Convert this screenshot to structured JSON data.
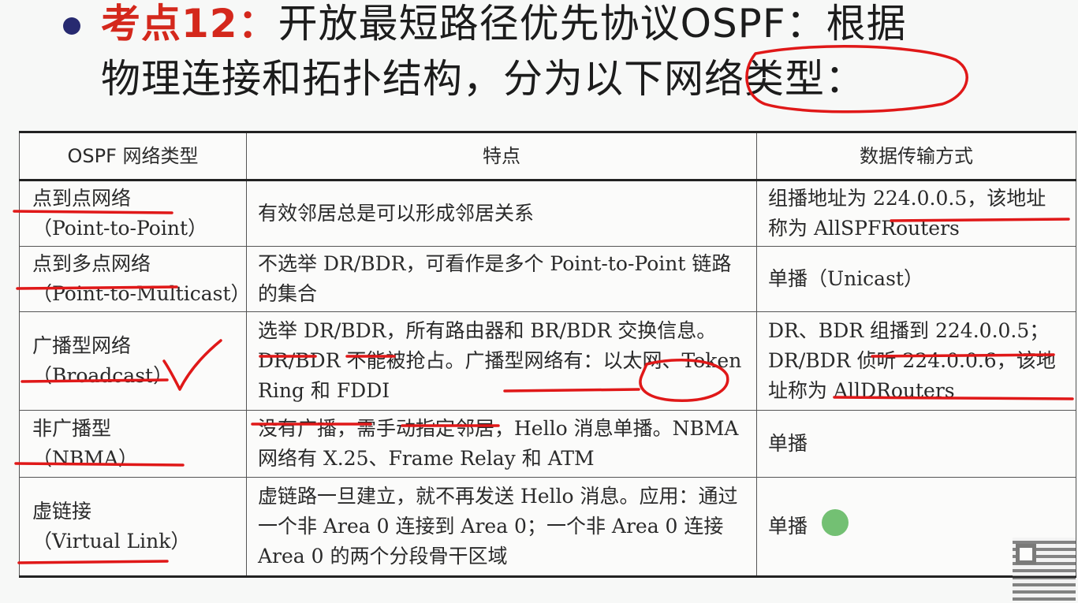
{
  "header": {
    "label": "考点12：",
    "line1": "开放最短路径优先协议OSPF：根据",
    "line2": "物理连接和拓扑结构，分为以下网络类型："
  },
  "table": {
    "columns": [
      "OSPF 网络类型",
      "特点",
      "数据传输方式"
    ],
    "rows": [
      {
        "type_zh": "点到点网络",
        "type_en": "（Point-to-Point）",
        "feature": "有效邻居总是可以形成邻居关系",
        "transmission": "组播地址为 224.0.0.5，该地址称为 AllSPFRouters"
      },
      {
        "type_zh": "点到多点网络",
        "type_en": "（Point-to-Multicast）",
        "feature": "不选举 DR/BDR，可看作是多个 Point-to-Point 链路的集合",
        "transmission": "单播（Unicast）"
      },
      {
        "type_zh": "广播型网络",
        "type_en": "（Broadcast）",
        "feature": "选举 DR/BDR，所有路由器和 BR/BDR 交换信息。DR/BDR 不能被抢占。广播型网络有：以太网、Token Ring 和 FDDI",
        "transmission": "DR、BDR 组播到 224.0.0.5；DR/BDR 侦听 224.0.0.6，该地址称为 AllDRouters"
      },
      {
        "type_zh": "非广播型",
        "type_en": "（NBMA）",
        "feature": "没有广播，需手动指定邻居，Hello 消息单播。NBMA 网络有 X.25、Frame Relay 和 ATM",
        "transmission": "单播"
      },
      {
        "type_zh": "虚链接",
        "type_en": "（Virtual Link）",
        "feature": "虚链路一旦建立，就不再发送 Hello 消息。应用：通过一个非 Area 0 连接到 Area 0；一个非 Area 0 连接 Area 0 的两个分段骨干区域",
        "transmission": "单播"
      }
    ]
  },
  "colors": {
    "accent_red": "#d4281c",
    "bullet": "#272a70",
    "annotation_red": "#e01818",
    "cursor_green": "#5ab55a"
  },
  "icons": {
    "bullet": "filled-circle",
    "pointer": "green-cursor-dot",
    "watermark": "qr-code"
  }
}
